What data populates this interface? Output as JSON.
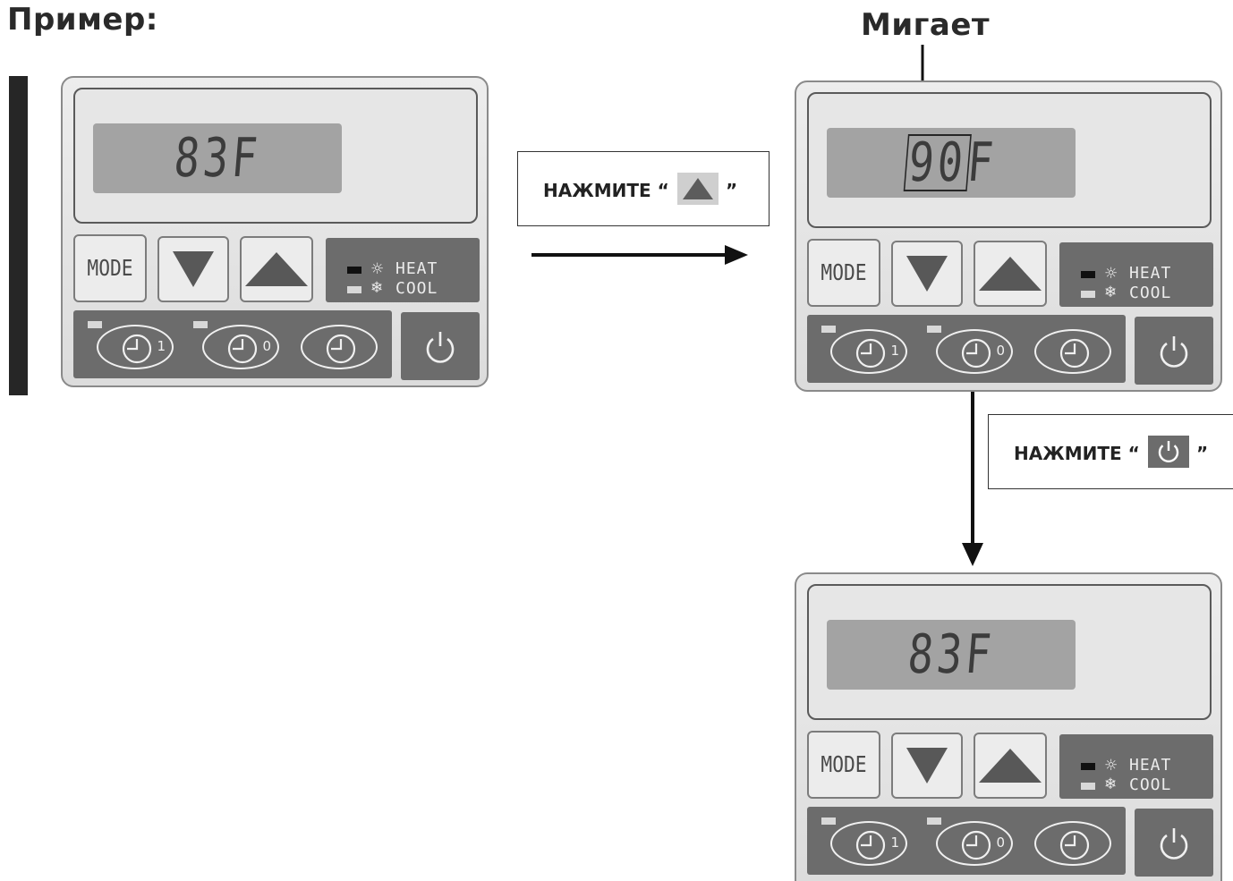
{
  "heading": "Пример:",
  "blink_label": "Мигает",
  "key_labels": {
    "mode": "MODE",
    "heat": "HEAT",
    "cool": "COOL",
    "timer_on_suffix": "1",
    "timer_off_suffix": "0"
  },
  "panels": [
    {
      "display_blink": "",
      "display_rest": "83F"
    },
    {
      "display_blink": "90",
      "display_rest": "F"
    },
    {
      "display_blink": "",
      "display_rest": "83F"
    }
  ],
  "instructions": {
    "step1": {
      "prefix": "НАЖМИТЕ “",
      "button_icon": "up-arrow-icon",
      "suffix": "”"
    },
    "step2": {
      "prefix": "НАЖМИТЕ “",
      "button_icon": "power-icon",
      "suffix": "”"
    }
  },
  "colors": {
    "panel_dark": "#6c6c6c",
    "lcd": "#a3a3a3",
    "text_dark": "#222222"
  }
}
